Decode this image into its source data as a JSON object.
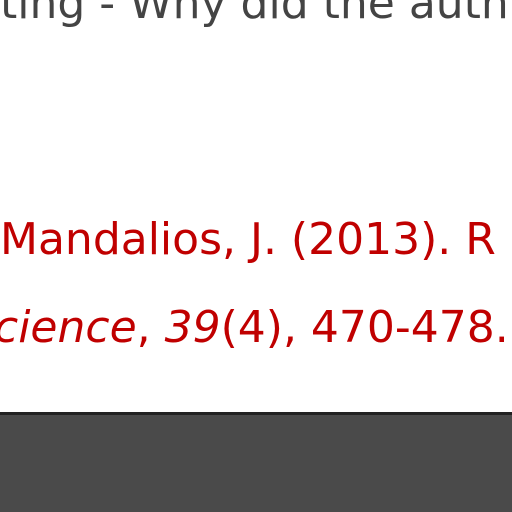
{
  "heading": {
    "text": "ting - Why did the auth"
  },
  "reference": {
    "line1": "Mandalios, J. (2013). R",
    "line2_journal": "cience",
    "line2_sep1": ", ",
    "line2_volume": "39",
    "line2_issue": "(4)",
    "line2_pages": ", 470-478."
  },
  "colors": {
    "link": "#c00000",
    "text": "#444444",
    "bottom_bar": "#4a4a4a"
  }
}
